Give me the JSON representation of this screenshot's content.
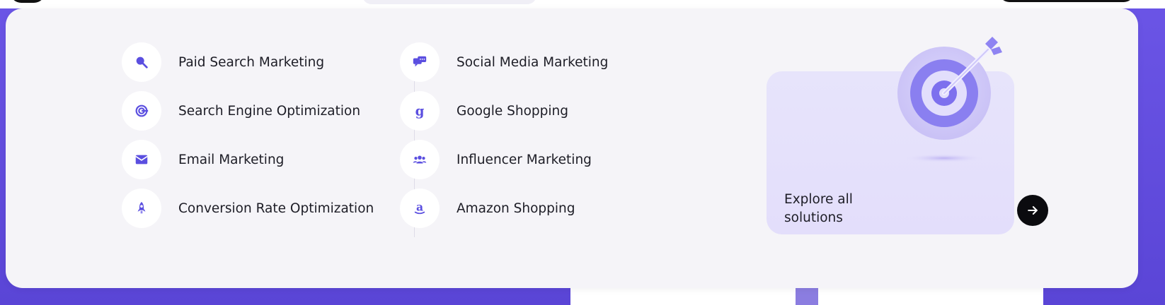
{
  "colors": {
    "accent": "#5b4fe0",
    "background": "#6b55e6",
    "panel": "#f5f4f8",
    "explore_card": "#e5e1fb"
  },
  "menu": {
    "column_left": [
      {
        "label": "Paid Search Marketing",
        "icon": "search-icon"
      },
      {
        "label": "Search Engine Optimization",
        "icon": "target-seo-icon"
      },
      {
        "label": "Email Marketing",
        "icon": "envelope-icon"
      },
      {
        "label": "Conversion Rate Optimization",
        "icon": "rocket-icon"
      }
    ],
    "column_right": [
      {
        "label": "Social Media Marketing",
        "icon": "chat-bubbles-icon"
      },
      {
        "label": "Google Shopping",
        "icon": "google-g-icon"
      },
      {
        "label": "Influencer Marketing",
        "icon": "people-group-icon"
      },
      {
        "label": "Amazon Shopping",
        "icon": "amazon-icon"
      }
    ]
  },
  "explore": {
    "label": "Explore all solutions",
    "icon": "arrow-right-icon",
    "illustration": "target-dart-icon"
  }
}
